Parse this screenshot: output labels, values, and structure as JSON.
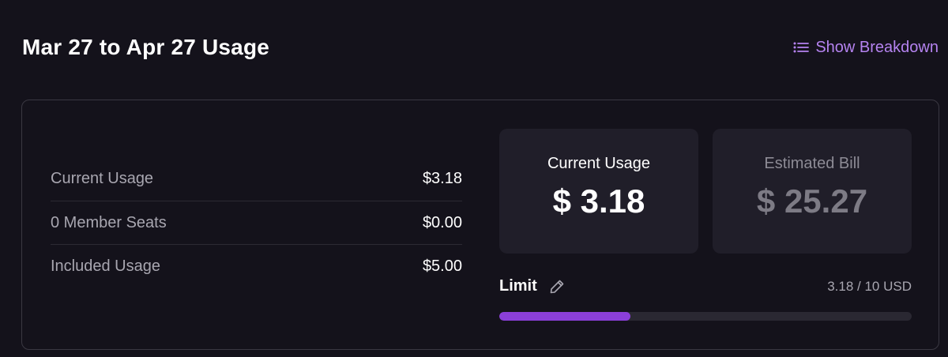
{
  "header": {
    "title": "Mar 27 to Apr 27 Usage",
    "breakdown_label": "Show Breakdown",
    "breakdown_icon": "list-icon"
  },
  "summary_rows": [
    {
      "label": "Current Usage",
      "value": "$3.18"
    },
    {
      "label": "0 Member Seats",
      "value": "$0.00"
    },
    {
      "label": "Included Usage",
      "value": "$5.00"
    }
  ],
  "current_usage": {
    "label": "Current Usage",
    "value": "$ 3.18"
  },
  "estimated_bill": {
    "label": "Estimated Bill",
    "value": "$ 25.27"
  },
  "limit": {
    "label": "Limit",
    "edit_icon": "pencil-icon",
    "amount_text": "3.18 / 10 USD",
    "used": 3.18,
    "max": 10
  },
  "colors": {
    "background": "#14121b",
    "accent": "#b583f0",
    "progress": "#8b3fd9",
    "box": "#201e29"
  }
}
